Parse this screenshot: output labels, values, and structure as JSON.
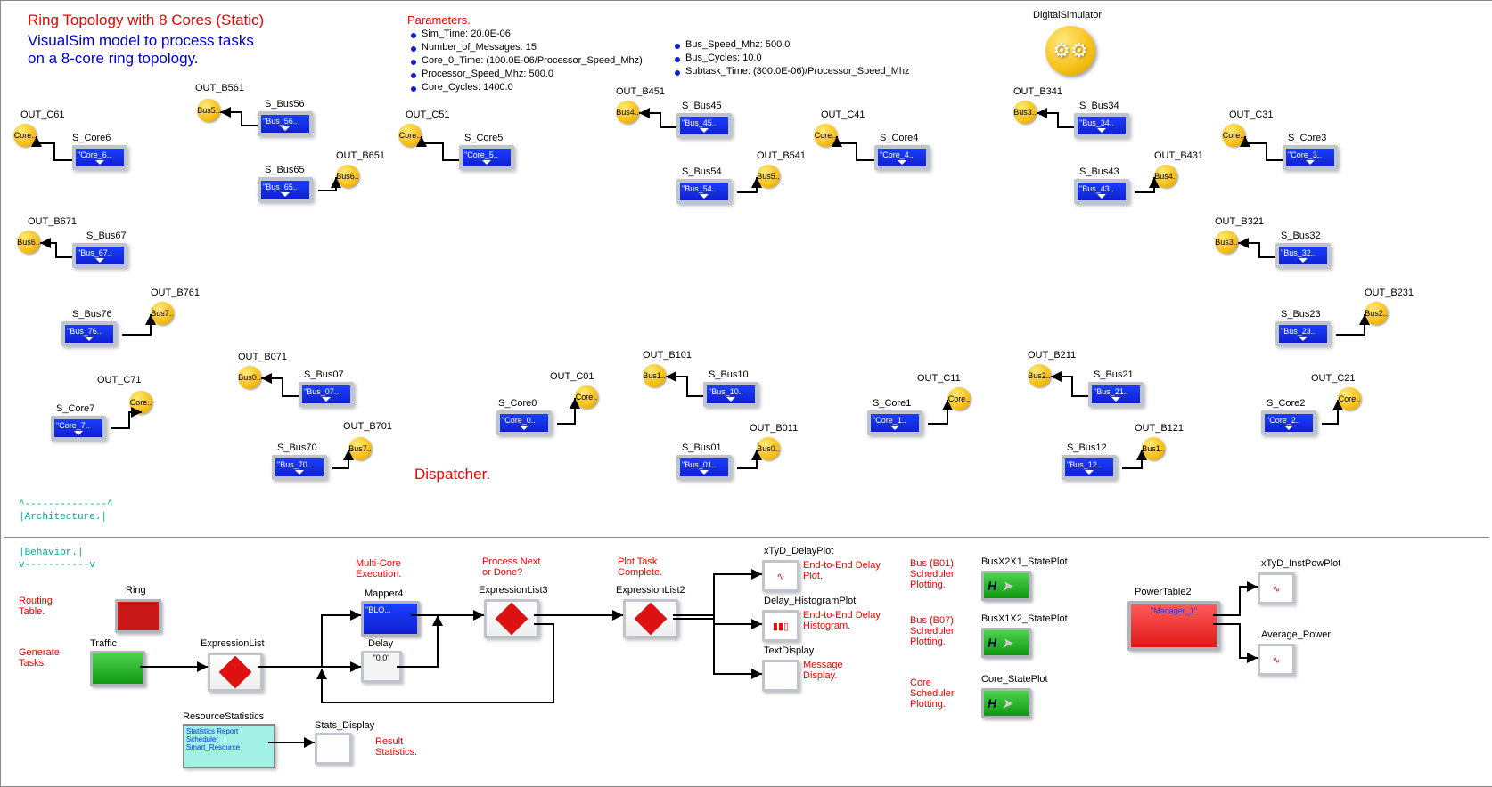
{
  "header": {
    "title": "Ring Topology with 8 Cores (Static)",
    "subtitle1": "VisualSim model to process tasks",
    "subtitle2": "on a 8-core ring topology.",
    "params_header": "Parameters.",
    "params_left": [
      "Sim_Time: 20.0E-06",
      "Number_of_Messages: 15",
      "Core_0_Time: (100.0E-06/Processor_Speed_Mhz)",
      "Processor_Speed_Mhz: 500.0",
      "Core_Cycles: 1400.0"
    ],
    "params_right": [
      "Bus_Speed_Mhz: 500.0",
      "Bus_Cycles: 10.0",
      "Subtask_Time: (300.0E-06)/Processor_Speed_Mhz"
    ],
    "digital_sim": "DigitalSimulator"
  },
  "sections": {
    "arch_top": "^--------------^",
    "arch_mid": "|Architecture.|",
    "behav_mid": "|Behavior.|",
    "behav_bot": "v-----------v",
    "dispatcher": "Dispatcher."
  },
  "arch_labels": {
    "OUT_C61": "OUT_C61",
    "OUT_B561": "OUT_B561",
    "OUT_C51": "OUT_C51",
    "OUT_B451": "OUT_B451",
    "OUT_C41": "OUT_C41",
    "OUT_B341": "OUT_B341",
    "OUT_C31": "OUT_C31",
    "OUT_B651": "OUT_B651",
    "OUT_B541": "OUT_B541",
    "OUT_B431": "OUT_B431",
    "OUT_B671": "OUT_B671",
    "OUT_B761": "OUT_B761",
    "OUT_B071": "OUT_B071",
    "OUT_B701": "OUT_B701",
    "OUT_B101": "OUT_B101",
    "OUT_B011": "OUT_B011",
    "OUT_B211": "OUT_B211",
    "OUT_B121": "OUT_B121",
    "OUT_B321": "OUT_B321",
    "OUT_B231": "OUT_B231",
    "OUT_C71": "OUT_C71",
    "OUT_C01": "OUT_C01",
    "OUT_C11": "OUT_C11",
    "OUT_C21": "OUT_C21",
    "S_Core6": "S_Core6",
    "S_Core5": "S_Core5",
    "S_Core4": "S_Core4",
    "S_Core3": "S_Core3",
    "S_Core7": "S_Core7",
    "S_Core0": "S_Core0",
    "S_Core1": "S_Core1",
    "S_Core2": "S_Core2",
    "S_Bus56": "S_Bus56",
    "S_Bus65": "S_Bus65",
    "S_Bus45": "S_Bus45",
    "S_Bus54": "S_Bus54",
    "S_Bus34": "S_Bus34",
    "S_Bus43": "S_Bus43",
    "S_Bus32": "S_Bus32",
    "S_Bus23": "S_Bus23",
    "S_Bus67": "S_Bus67",
    "S_Bus76": "S_Bus76",
    "S_Bus07": "S_Bus07",
    "S_Bus70": "S_Bus70",
    "S_Bus10": "S_Bus10",
    "S_Bus01": "S_Bus01",
    "S_Bus21": "S_Bus21",
    "S_Bus12": "S_Bus12"
  },
  "block_text": {
    "Core_X": "\"Core_...",
    "Bus_56": "\"Bus_56..",
    "Bus_65": "\"Bus_65..",
    "Bus_45": "\"Bus_45..",
    "Bus_54": "\"Bus_54..",
    "Bus_34": "\"Bus_34..",
    "Bus_43": "\"Bus_43..",
    "Bus_32": "\"Bus_32..",
    "Bus_23": "\"Bus_23..",
    "Bus_67": "\"Bus_67..",
    "Bus_76": "\"Bus_76..",
    "Bus_07": "\"Bus_07..",
    "Bus_70": "\"Bus_70..",
    "Bus_10": "\"Bus_10..",
    "Bus_01": "\"Bus_01..",
    "Bus_21": "\"Bus_21..",
    "Bus_12": "\"Bus_12..",
    "Core_6": "\"Core_6..",
    "Core_5": "\"Core_5..",
    "Core_4": "\"Core_4..",
    "Core_3": "\"Core_3..",
    "Core_7": "\"Core_7..",
    "Core_0": "\"Core_0..",
    "Core_1": "\"Core_1..",
    "Core_2": "\"Core_2..",
    "CorePort": "Core..",
    "BusPort": "Bus.."
  },
  "behavior": {
    "routing_table": "Routing\nTable.",
    "generate_tasks": "Generate\nTasks.",
    "ring": "Ring",
    "traffic": "Traffic",
    "expr": "ExpressionList",
    "mapper4": "Mapper4",
    "mapper4_inner": "\"BLO...",
    "multi_core": "Multi-Core\nExecution.",
    "delay": "Delay",
    "delay_inner": "\"0.0\"",
    "expr3": "ExpressionList3",
    "process_next": "Process Next\nor Done?",
    "expr2": "ExpressionList2",
    "plot_task": "Plot Task\nComplete.",
    "xTyD": "xTyD_DelayPlot",
    "e2e_delay": "End-to-End Delay\nPlot.",
    "hist": "Delay_HistogramPlot",
    "e2e_hist": "End-to-End Delay\nHistogram.",
    "text_disp": "TextDisplay",
    "msg_disp": "Message\nDisplay.",
    "resource": "ResourceStatistics",
    "resource_inner": "Statistics Report\nScheduler\nSmart_Resource",
    "stats_disp": "Stats_Display",
    "result_stats": "Result\nStatistics.",
    "b01": "Bus (B01)\nScheduler\nPlotting.",
    "b07": "Bus (B07)\nScheduler\nPlotting.",
    "core_sched": "Core\nScheduler\nPlotting.",
    "state21": "BusX2X1_StatePlot",
    "state12": "BusX1X2_StatePlot",
    "core_state": "Core_StatePlot",
    "power_table": "PowerTable2",
    "power_inner": "\"Manager_1\"",
    "inst_pow": "xTyD_InstPowPlot",
    "avg_pow": "Average_Power",
    "H": "H"
  }
}
